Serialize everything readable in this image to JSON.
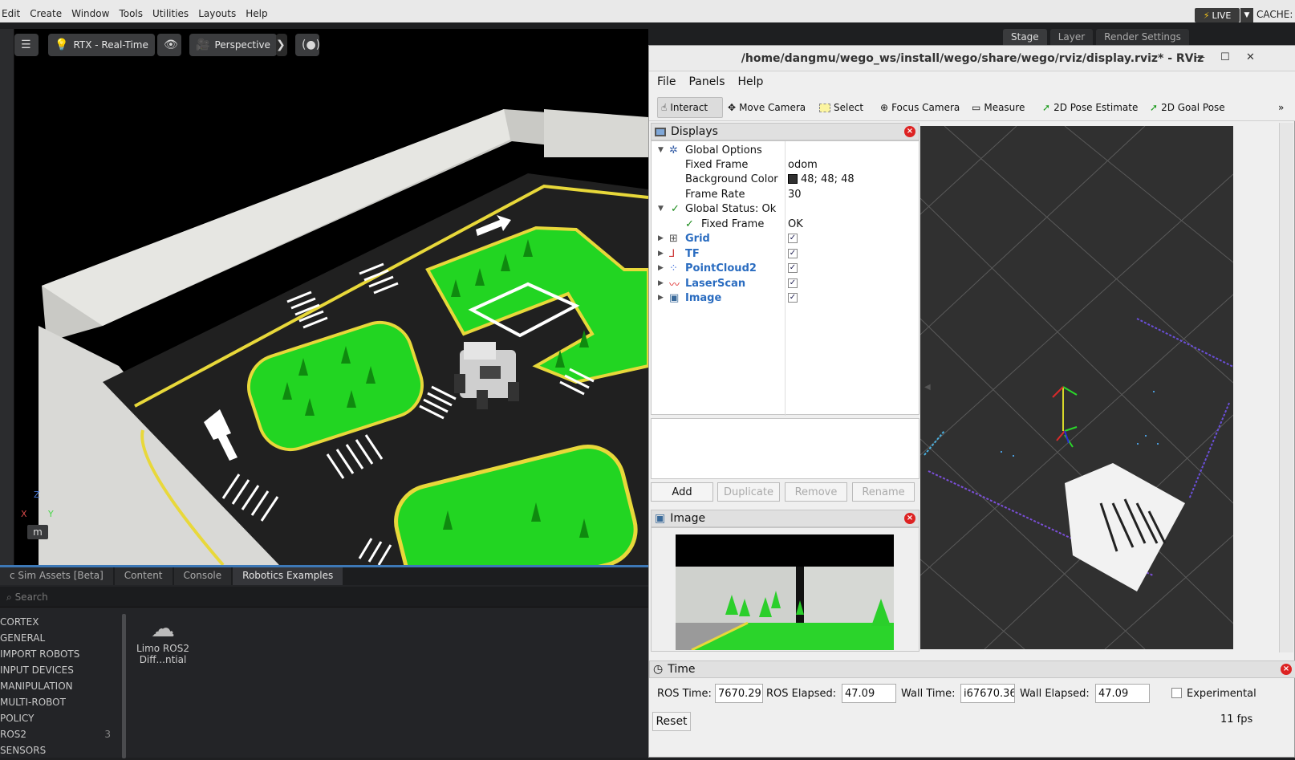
{
  "isaac": {
    "menu": [
      "Edit",
      "Create",
      "Window",
      "Tools",
      "Utilities",
      "Layouts",
      "Help"
    ],
    "live_label": "LIVE",
    "cache_label": "CACHE:",
    "viewport": {
      "render_mode": "RTX - Real-Time",
      "camera": "Perspective",
      "units": "m",
      "axes": {
        "z": "Z",
        "x": "X",
        "y": "Y"
      }
    },
    "stage_tabs": [
      "Stage",
      "Layer",
      "Render Settings"
    ],
    "bottom_tabs": [
      "c Sim Assets [Beta]",
      "Content",
      "Console",
      "Robotics Examples"
    ],
    "search_placeholder": "Search",
    "tree": [
      {
        "label": "CORTEX",
        "count": ""
      },
      {
        "label": "GENERAL",
        "count": ""
      },
      {
        "label": "IMPORT ROBOTS",
        "count": ""
      },
      {
        "label": "INPUT DEVICES",
        "count": ""
      },
      {
        "label": "MANIPULATION",
        "count": ""
      },
      {
        "label": "MULTI-ROBOT",
        "count": ""
      },
      {
        "label": "POLICY",
        "count": ""
      },
      {
        "label": "ROS2",
        "count": "3"
      },
      {
        "label": "SENSORS",
        "count": ""
      }
    ],
    "file_item": {
      "line1": "Limo ROS2",
      "line2": "Diff...ntial"
    }
  },
  "rviz": {
    "title": "/home/dangmu/wego_ws/install/wego/share/wego/rviz/display.rviz* - RViz",
    "menu": [
      "File",
      "Panels",
      "Help"
    ],
    "tools": [
      "Interact",
      "Move Camera",
      "Select",
      "Focus Camera",
      "Measure",
      "2D Pose Estimate",
      "2D Goal Pose"
    ],
    "displays_title": "Displays",
    "global_options": "Global Options",
    "fixed_frame_label": "Fixed Frame",
    "fixed_frame_value": "odom",
    "bg_color_label": "Background Color",
    "bg_color_value": "48; 48; 48",
    "frame_rate_label": "Frame Rate",
    "frame_rate_value": "30",
    "global_status": "Global Status: Ok",
    "status_fixed_frame_label": "Fixed Frame",
    "status_fixed_frame_value": "OK",
    "display_items": [
      "Grid",
      "TF",
      "PointCloud2",
      "LaserScan",
      "Image"
    ],
    "buttons": [
      "Add",
      "Duplicate",
      "Remove",
      "Rename"
    ],
    "image_panel_title": "Image",
    "time_title": "Time",
    "ros_time_label": "ROS Time:",
    "ros_time_value": "7670.29",
    "ros_elapsed_label": "ROS Elapsed:",
    "ros_elapsed_value": "47.09",
    "wall_time_label": "Wall Time:",
    "wall_time_value": "i67670.36",
    "wall_elapsed_label": "Wall Elapsed:",
    "wall_elapsed_value": "47.09",
    "experimental_label": "Experimental",
    "reset_label": "Reset",
    "fps": "11 fps"
  }
}
